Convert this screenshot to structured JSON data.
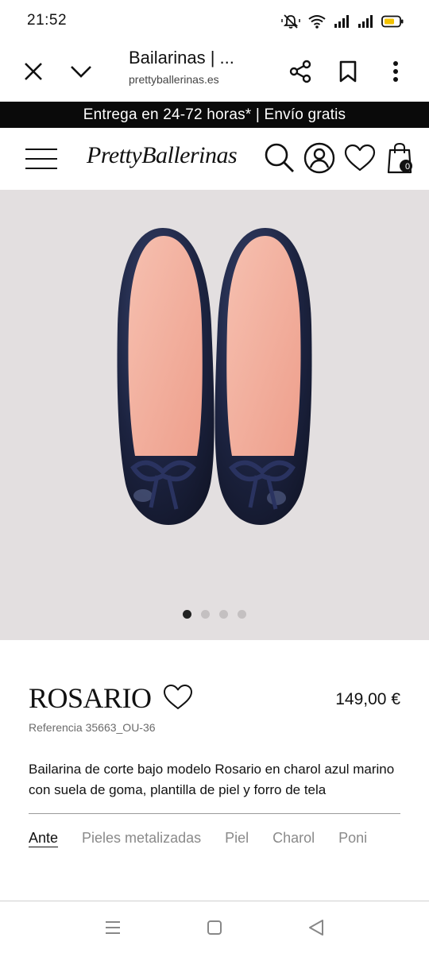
{
  "status_bar": {
    "time": "21:52",
    "icons": [
      "mute-icon",
      "wifi-icon",
      "signal-icon",
      "signal-icon",
      "battery-icon"
    ],
    "battery_color": "#f2c200"
  },
  "browser": {
    "title": "Bailarinas | ...",
    "url": "prettyballerinas.es",
    "icons": [
      "close-icon",
      "chevron-down-icon",
      "share-icon",
      "bookmark-icon",
      "more-icon"
    ]
  },
  "promo": {
    "text": "Entrega en 24-72 horas* | Envío gratis"
  },
  "site_header": {
    "logo": "PrettyBallerinas",
    "cart_count": "0",
    "icons": [
      "menu-icon",
      "search-icon",
      "account-icon",
      "heart-icon",
      "shopping-bag-icon"
    ]
  },
  "product": {
    "image_slides": 4,
    "active_slide": 1,
    "name": "ROSARIO",
    "price": "149,00 €",
    "reference": "Referencia 35663_OU-36",
    "description": "Bailarina de corte bajo modelo Rosario en charol azul marino con suela de goma, plantilla de piel y forro de tela",
    "material_tabs": [
      {
        "label": "Ante",
        "active": true
      },
      {
        "label": "Pieles metalizadas",
        "active": false
      },
      {
        "label": "Piel",
        "active": false
      },
      {
        "label": "Charol",
        "active": false
      },
      {
        "label": "Poni",
        "active": false
      }
    ]
  },
  "colors": {
    "promo_background": "#0a0a0a",
    "image_background": "#e3dfe0",
    "shoe_color": "#1c2340",
    "insole_color": "#f2b1a0"
  },
  "android_nav": {
    "icons": [
      "recents-icon",
      "home-icon",
      "back-icon"
    ]
  }
}
